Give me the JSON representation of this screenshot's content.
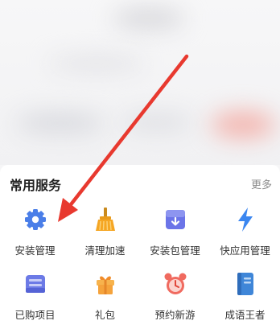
{
  "section": {
    "title": "常用服务",
    "more": "更多"
  },
  "services": [
    {
      "label": "安装管理",
      "icon": "gear-icon"
    },
    {
      "label": "清理加速",
      "icon": "broom-icon"
    },
    {
      "label": "安装包管理",
      "icon": "package-icon"
    },
    {
      "label": "快应用管理",
      "icon": "lightning-icon"
    },
    {
      "label": "已购项目",
      "icon": "purchased-box-icon"
    },
    {
      "label": "礼包",
      "icon": "gift-icon"
    },
    {
      "label": "预约新游",
      "icon": "alarm-clock-icon"
    },
    {
      "label": "成语王者",
      "icon": "book-icon"
    }
  ],
  "colors": {
    "arrow": "#e8392f",
    "gear": "#4a7ee8",
    "broom": "#f5a623",
    "package": "#6b74e8",
    "lightning": "#3a86f0",
    "purchased": "#6c7ae6",
    "gift": "#f5a33c",
    "clock": "#f06a5f",
    "book": "#3f86d8"
  }
}
